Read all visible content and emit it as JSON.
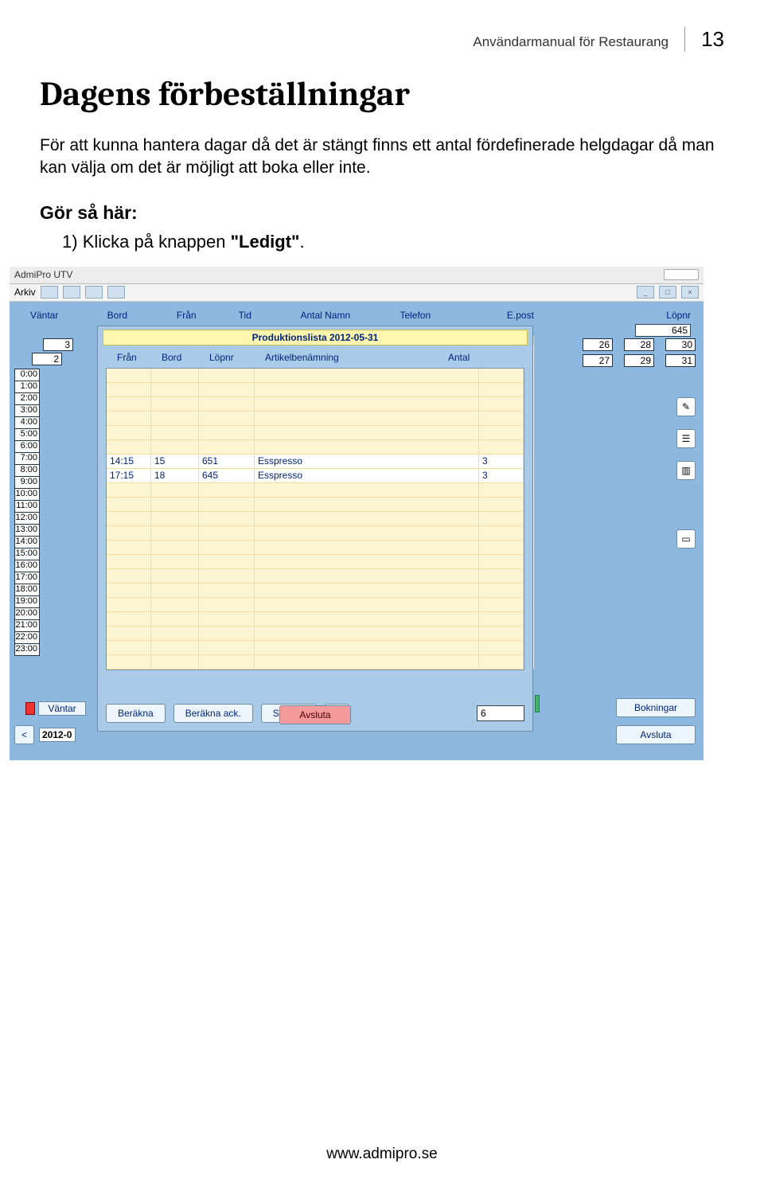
{
  "header": {
    "running": "Användarmanual för Restaurang",
    "page": "13"
  },
  "heading": "Dagens förbeställningar",
  "intro": "För att kunna hantera dagar då det är stängt finns ett antal fördefinerade helgdagar då man kan välja om det är möjligt att boka eller inte.",
  "steps": {
    "title": "Gör så här:",
    "num": "1)",
    "text": "Klicka på knappen ",
    "bold": "\"Ledigt\"",
    "tail": "."
  },
  "app": {
    "title": "AdmiPro UTV",
    "menu": "Arkiv",
    "columns": {
      "vantar": "Väntar",
      "bord": "Bord",
      "fran": "Från",
      "tid": "Tid",
      "antal": "Antal Namn",
      "telefon": "Telefon",
      "epost": "E.post",
      "lopnr": "Löpnr"
    },
    "lopnr_value": "645",
    "cal_right_top": [
      "26",
      "28",
      "30"
    ],
    "cal_right_bot": [
      "27",
      "29",
      "31"
    ],
    "cal_left_top": [
      "3"
    ],
    "cal_left_bot": [
      "2"
    ],
    "times": [
      "0:00",
      "1:00",
      "2:00",
      "3:00",
      "4:00",
      "5:00",
      "6:00",
      "7:00",
      "8:00",
      "9:00",
      "10:00",
      "11:00",
      "12:00",
      "13:00",
      "14:00",
      "15:00",
      "16:00",
      "17:00",
      "18:00",
      "19:00",
      "20:00",
      "21:00",
      "22:00",
      "23:00"
    ],
    "vantar_btn": "Väntar",
    "back_btn": "<",
    "date_val": "2012-0",
    "side": {
      "bokningar": "Bokningar",
      "avsluta": "Avsluta"
    }
  },
  "dialog": {
    "title": "Produktionslista 2012-05-31",
    "cols": {
      "fran": "Från",
      "bord": "Bord",
      "lopnr": "Löpnr",
      "art": "Artikelbenämning",
      "antal": "Antal"
    },
    "rows": [
      {
        "fran": "14:15",
        "bord": "15",
        "lopnr": "651",
        "art": "Esspresso",
        "antal": "3"
      },
      {
        "fran": "17:15",
        "bord": "18",
        "lopnr": "645",
        "art": "Esspresso",
        "antal": "3"
      }
    ],
    "empty_above": 6,
    "empty_below": 13,
    "total": "6",
    "buttons": {
      "berakna": "Beräkna",
      "berakna_ack": "Beräkna ack.",
      "skriv_ut": "Skriv ut",
      "avsluta": "Avsluta"
    }
  },
  "footer": "www.admipro.se"
}
